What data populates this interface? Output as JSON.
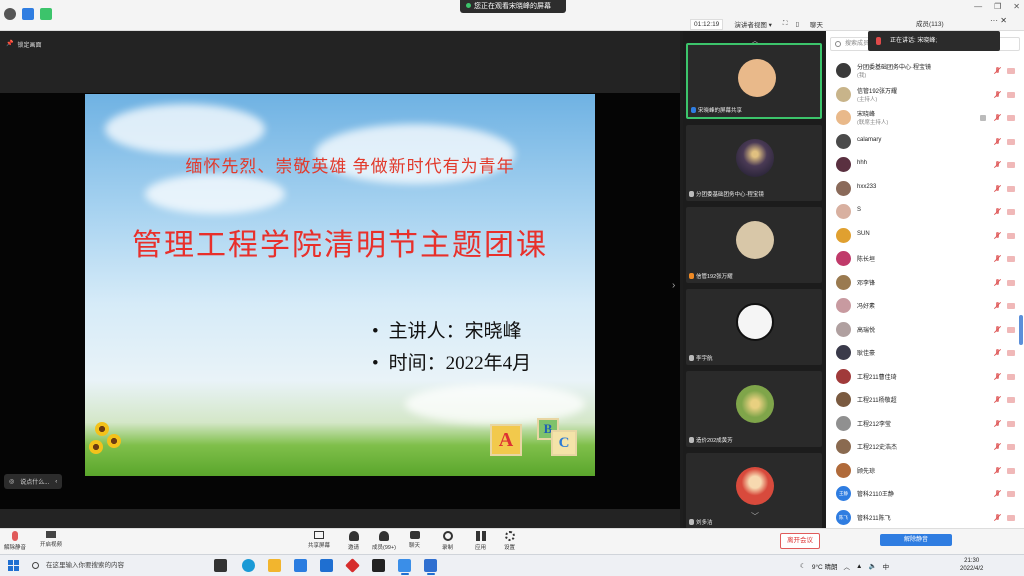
{
  "top_bar": {
    "share_banner": "您正在观看宋晓峰的屏幕",
    "timer": "01:12:19",
    "view_mode": "演讲者视图",
    "chat_tab": "聊天",
    "members_title": "成员(113)",
    "more_label": "···"
  },
  "stage": {
    "pin_label": "锁定画面",
    "speaking_chip": "说点什么..."
  },
  "slide": {
    "subtitle": "缅怀先烈、崇敬英雄 争做新时代有为青年",
    "title": "管理工程学院清明节主题团课",
    "bullets": [
      "主讲人：宋晓峰",
      "时间：2022年4月"
    ],
    "blocks": [
      "A",
      "B",
      "C"
    ]
  },
  "video_tiles": [
    {
      "name": "宋晓峰的屏幕共享",
      "avatar_color": "#e9b98a"
    },
    {
      "name": "分团委基础团务中心·程宝镜",
      "avatar_color": "#4a3a55"
    },
    {
      "name": "信管192张万耀",
      "avatar_color": "#d8c7a8"
    },
    {
      "name": "李宇航",
      "avatar_color": "#f5f5f5"
    },
    {
      "name": "造价202成黄芳",
      "avatar_color": "#7fa54a"
    },
    {
      "name": "刘多洁",
      "avatar_color": "#d84a3c"
    }
  ],
  "talk_popup": "正在讲话: 宋晓峰;",
  "search_placeholder": "搜索成员",
  "members": [
    {
      "name": "分团委基础团务中心·程宝镜",
      "role": "(我)",
      "color": "#3a3a3a"
    },
    {
      "name": "信管192张万耀",
      "role": "(主持人)",
      "color": "#c8b48a"
    },
    {
      "name": "宋晓峰",
      "role": "(联席主持人)",
      "color": "#e9b98a"
    },
    {
      "name": "calamary",
      "role": "",
      "color": "#4a4a4a"
    },
    {
      "name": "hhh",
      "role": "",
      "color": "#5a3040"
    },
    {
      "name": "hxx233",
      "role": "",
      "color": "#8a6a5a"
    },
    {
      "name": "S",
      "role": "",
      "color": "#d8b0a0"
    },
    {
      "name": "SUN",
      "role": "",
      "color": "#e0a030"
    },
    {
      "name": "陈长垣",
      "role": "",
      "color": "#c03a6a"
    },
    {
      "name": "邓李锋",
      "role": "",
      "color": "#9a7a50"
    },
    {
      "name": "冯好素",
      "role": "",
      "color": "#c89aa0"
    },
    {
      "name": "高瑞悦",
      "role": "",
      "color": "#b0a0a0"
    },
    {
      "name": "耿佳豪",
      "role": "",
      "color": "#3a3a4a"
    },
    {
      "name": "工程211曹佳琦",
      "role": "",
      "color": "#a03a3a"
    },
    {
      "name": "工程211杨敬超",
      "role": "",
      "color": "#7a5a40"
    },
    {
      "name": "工程212李莹",
      "role": "",
      "color": "#909090"
    },
    {
      "name": "工程212史浩杰",
      "role": "",
      "color": "#8a6a50"
    },
    {
      "name": "顾先琼",
      "role": "",
      "color": "#b06a3a"
    },
    {
      "name": "管科2110王静",
      "role": "",
      "color": "#2f7de1",
      "initials": "王静"
    },
    {
      "name": "管科211陈飞",
      "role": "",
      "color": "#2f7de1",
      "initials": "陈飞"
    }
  ],
  "toolbar": {
    "mute": "解除静音",
    "video": "开启视频",
    "share": "共享屏幕",
    "invite": "邀请",
    "members": "成员(99+)",
    "chat": "聊天",
    "record": "录制",
    "apps": "应用",
    "settings": "设置",
    "leave": "离开会议",
    "mute_all": "解除静音"
  },
  "taskbar": {
    "search_placeholder": "在这里输入你要搜索的内容",
    "weather": "9°C 晴朗",
    "ime": "中",
    "time": "21:30",
    "date": "2022/4/2"
  },
  "colors": {
    "accent": "#2f7de1",
    "active_speaker": "#3cc46b",
    "leave": "#e05a5a"
  }
}
